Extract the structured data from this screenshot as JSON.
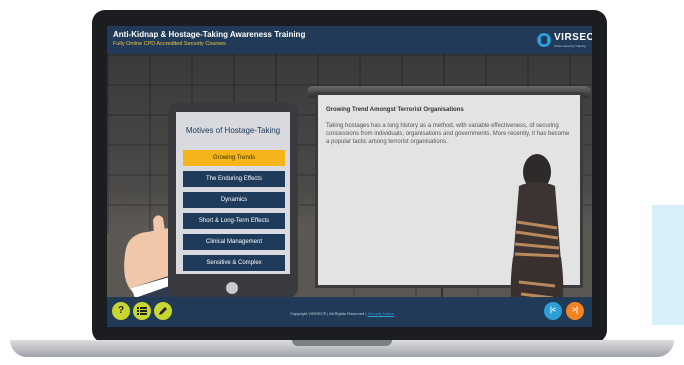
{
  "course": {
    "title": "Anti-Kidnap & Hostage-Taking Awareness Training",
    "subtitle": "Fully Online CPD Accredited Security Courses"
  },
  "logo": {
    "text": "VIRSEC",
    "tagline": "Online Security Training",
    "accent": "#2a9fd8"
  },
  "menu": {
    "title": "Motives of Hostage-Taking",
    "items": [
      {
        "label": "Growing Trends",
        "active": true
      },
      {
        "label": "The Enduring Effects",
        "active": false
      },
      {
        "label": "Dynamics",
        "active": false
      },
      {
        "label": "Short & Long-Term Effects",
        "active": false
      },
      {
        "label": "Clinical Management",
        "active": false
      },
      {
        "label": "Sensitive & Complex",
        "active": false
      }
    ]
  },
  "board": {
    "heading": "Growing Trend Amongst Terrorist Organisations",
    "body": "Taking hostages has a long history as a method, with variable effectiveness, of securing concessions from individuals, organisations and governments. More recently, it has become a popular tactic among terrorist organisations."
  },
  "footer": {
    "copyright": "Copyright VIRSEC® | All Rights Reserved | ",
    "security_link": "Security Notice",
    "help_icon": "question-icon",
    "menu_icon": "list-icon",
    "notes_icon": "pencil-icon",
    "help_color": "#c8d630",
    "prev_color": "#2a9fd8",
    "next_color": "#f2831f"
  },
  "colors": {
    "header": "#203a57",
    "active_item": "#f4b41a",
    "menu_item": "#1f3b5c"
  }
}
